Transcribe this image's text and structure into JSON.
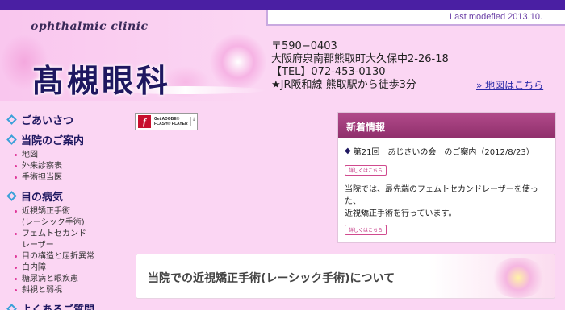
{
  "header": {
    "last_modified": "Last modefied 2013.10.",
    "clinic_en": "ophthalmic  clinic",
    "clinic_name": "髙槻眼科",
    "address": {
      "postal": "〒590−0403",
      "street": "大阪府泉南郡熊取町大久保中2-26-18",
      "tel": "【TEL】072-453-0130",
      "access": "★JR阪和線 熊取駅から徒歩3分"
    },
    "map_link": "» 地図はこちら"
  },
  "sidebar": {
    "sections": [
      {
        "label": "ごあいさつ",
        "items": []
      },
      {
        "label": "当院のご案内",
        "items": [
          "地図",
          "外来診察表",
          "手術担当医"
        ]
      },
      {
        "label": "目の病気",
        "items": [
          "近視矯正手術",
          "(レーシック手術)",
          "フェムトセカンド",
          "レーザー",
          "目の構造と屈折異常",
          "白内障",
          "糖尿病と眼疾患",
          "斜視と弱視"
        ]
      },
      {
        "label": "よくあるご質問",
        "items": []
      }
    ]
  },
  "flash_badge": {
    "line1": "Get ADOBE®",
    "line2": "FLASH® PLAYER"
  },
  "news": {
    "title": "新着情報",
    "item1": "第21回　あじさいの会　のご案内（2012/8/23）",
    "detail_label": "詳しくはこちら",
    "text_line1": "当院では、最先端のフェムトセカンドレーザーを使った、",
    "text_line2": "近視矯正手術を行っています。"
  },
  "lasik_banner": {
    "text": "当院での近視矯正手術(レーシック手術)について"
  },
  "colors": {
    "topbar": "#4a1fa3",
    "background": "#fbd6f3",
    "news_header": "#9a3876",
    "accent_text": "#1e1760"
  }
}
